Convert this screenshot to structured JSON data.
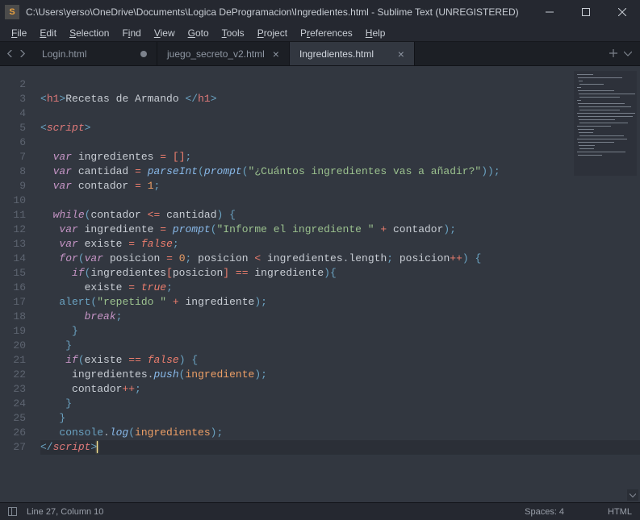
{
  "window": {
    "app_icon": "S",
    "title": "C:\\Users\\yerso\\OneDrive\\Documents\\Logica DeProgramacion\\Ingredientes.html - Sublime Text (UNREGISTERED)"
  },
  "menu": {
    "file": "File",
    "edit": "Edit",
    "selection": "Selection",
    "find": "Find",
    "view": "View",
    "goto": "Goto",
    "tools": "Tools",
    "project": "Project",
    "preferences": "Preferences",
    "help": "Help"
  },
  "tabs": [
    {
      "label": "Login.html",
      "dirty": true,
      "active": false
    },
    {
      "label": "juego_secreto_v2.html",
      "dirty": false,
      "active": false
    },
    {
      "label": "Ingredientes.html",
      "dirty": false,
      "active": true
    }
  ],
  "status": {
    "pos": "Line 27, Column 10",
    "spaces": "Spaces: 4",
    "lang": "HTML"
  },
  "code": {
    "line_start": 2,
    "text_h1": "Recetas de Armando ",
    "str_prompt1": "\"¿Cuántos ingredientes vas a añadir?\"",
    "str_prompt2": "\"Informe el ingrediente \"",
    "str_alert": "\"repetido \""
  }
}
